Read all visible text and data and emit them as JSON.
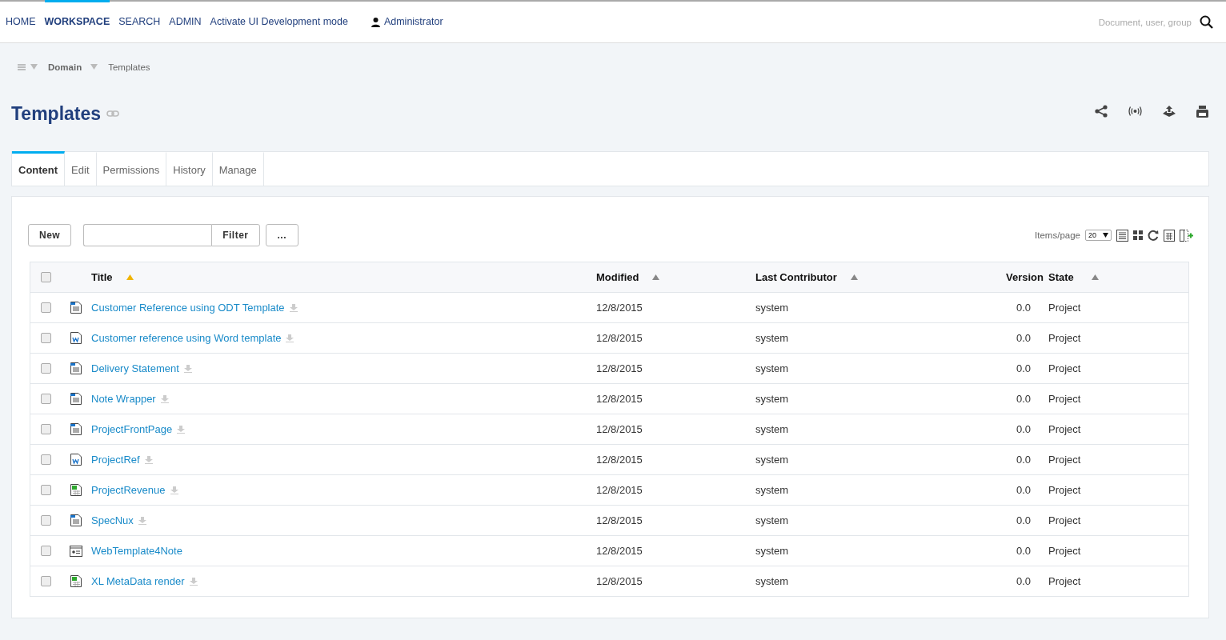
{
  "nav": {
    "items": [
      {
        "label": "HOME",
        "selected": false
      },
      {
        "label": "WORKSPACE",
        "selected": true
      },
      {
        "label": "SEARCH",
        "selected": false
      },
      {
        "label": "ADMIN",
        "selected": false
      },
      {
        "label": "Activate UI Development mode",
        "selected": false
      }
    ],
    "user": "Administrator",
    "search": {
      "placeholder": "Document, user, group"
    }
  },
  "breadcrumb": [
    "Domain",
    "Templates"
  ],
  "title": "Templates",
  "tabs": [
    {
      "label": "Content",
      "selected": true
    },
    {
      "label": "Edit",
      "selected": false
    },
    {
      "label": "Permissions",
      "selected": false
    },
    {
      "label": "History",
      "selected": false
    },
    {
      "label": "Manage",
      "selected": false
    }
  ],
  "toolbar": {
    "new": "New",
    "filter": "Filter",
    "more": "...",
    "items_per_page_label": "Items/page",
    "items_per_page": "20"
  },
  "table": {
    "columns": [
      {
        "label": "Title",
        "sortable": true,
        "sorted": true
      },
      {
        "label": "Modified",
        "sortable": true,
        "sorted": false
      },
      {
        "label": "Last Contributor",
        "sortable": true,
        "sorted": false
      },
      {
        "label": "Version",
        "sortable": false,
        "sorted": false
      },
      {
        "label": "State",
        "sortable": true,
        "sorted": false
      }
    ],
    "header_checked": false,
    "rows": [
      {
        "kind": "note",
        "title": "Customer Reference using ODT Template",
        "downloadable": true,
        "modified": "12/8/2015",
        "contributor": "system",
        "version": "0.0",
        "state": "Project",
        "checked": false
      },
      {
        "kind": "word",
        "title": "Customer reference using Word template",
        "downloadable": true,
        "modified": "12/8/2015",
        "contributor": "system",
        "version": "0.0",
        "state": "Project",
        "checked": false
      },
      {
        "kind": "note",
        "title": "Delivery Statement",
        "downloadable": true,
        "modified": "12/8/2015",
        "contributor": "system",
        "version": "0.0",
        "state": "Project",
        "checked": false
      },
      {
        "kind": "note",
        "title": "Note Wrapper",
        "downloadable": true,
        "modified": "12/8/2015",
        "contributor": "system",
        "version": "0.0",
        "state": "Project",
        "checked": false
      },
      {
        "kind": "note",
        "title": "ProjectFrontPage",
        "downloadable": true,
        "modified": "12/8/2015",
        "contributor": "system",
        "version": "0.0",
        "state": "Project",
        "checked": false
      },
      {
        "kind": "word",
        "title": "ProjectRef",
        "downloadable": true,
        "modified": "12/8/2015",
        "contributor": "system",
        "version": "0.0",
        "state": "Project",
        "checked": false
      },
      {
        "kind": "excel",
        "title": "ProjectRevenue",
        "downloadable": true,
        "modified": "12/8/2015",
        "contributor": "system",
        "version": "0.0",
        "state": "Project",
        "checked": false
      },
      {
        "kind": "note",
        "title": "SpecNux",
        "downloadable": true,
        "modified": "12/8/2015",
        "contributor": "system",
        "version": "0.0",
        "state": "Project",
        "checked": false
      },
      {
        "kind": "web",
        "title": "WebTemplate4Note",
        "downloadable": false,
        "modified": "12/8/2015",
        "contributor": "system",
        "version": "0.0",
        "state": "Project",
        "checked": false
      },
      {
        "kind": "excel",
        "title": "XL MetaData render",
        "downloadable": true,
        "modified": "12/8/2015",
        "contributor": "system",
        "version": "0.0",
        "state": "Project",
        "checked": false
      }
    ]
  }
}
